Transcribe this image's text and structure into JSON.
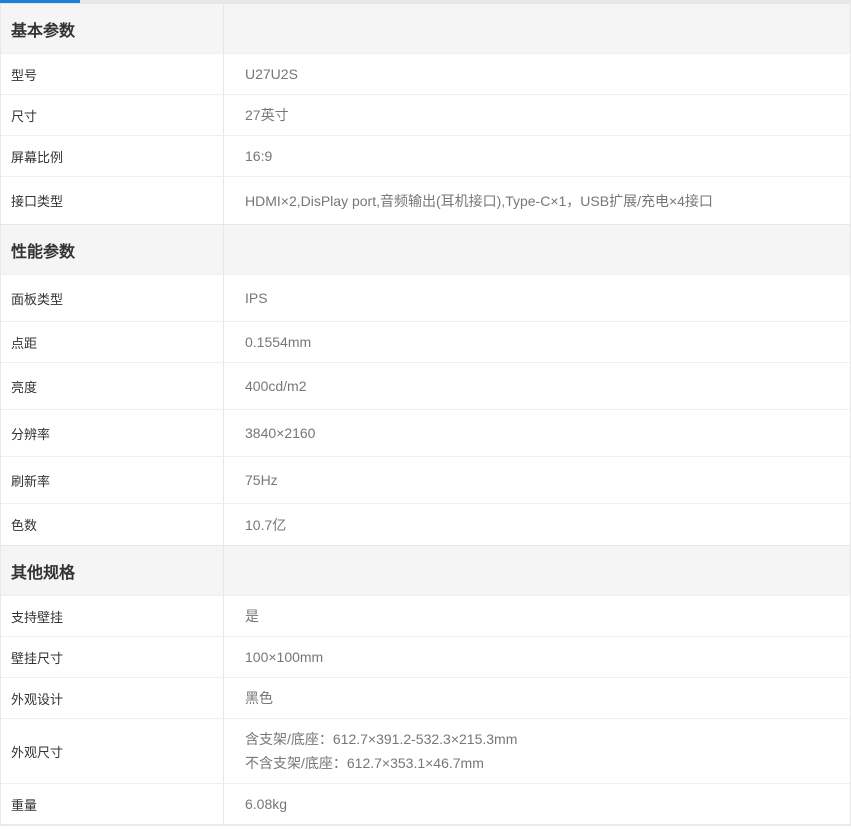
{
  "sections": [
    {
      "title": "基本参数",
      "rows": [
        {
          "label": "型号",
          "values": [
            "U27U2S"
          ]
        },
        {
          "label": "尺寸",
          "values": [
            "27英寸"
          ]
        },
        {
          "label": "屏幕比例",
          "values": [
            "16:9"
          ]
        },
        {
          "label": "接口类型",
          "values": [
            "HDMI×2,DisPlay port,音频输出(耳机接口),Type-C×1，USB扩展/充电×4接口"
          ]
        }
      ]
    },
    {
      "title": "性能参数",
      "rows": [
        {
          "label": "面板类型",
          "values": [
            "IPS"
          ]
        },
        {
          "label": "点距",
          "values": [
            "0.1554mm"
          ]
        },
        {
          "label": "亮度",
          "values": [
            "400cd/m2"
          ]
        },
        {
          "label": "分辨率",
          "values": [
            "3840×2160"
          ]
        },
        {
          "label": "刷新率",
          "values": [
            "75Hz"
          ]
        },
        {
          "label": "色数",
          "values": [
            "10.7亿"
          ]
        }
      ]
    },
    {
      "title": "其他规格",
      "rows": [
        {
          "label": "支持壁挂",
          "values": [
            "是"
          ]
        },
        {
          "label": "壁挂尺寸",
          "values": [
            "100×100mm"
          ]
        },
        {
          "label": "外观设计",
          "values": [
            "黑色"
          ]
        },
        {
          "label": "外观尺寸",
          "values": [
            "含支架/底座：612.7×391.2-532.3×215.3mm",
            "不含支架/底座：612.7×353.1×46.7mm"
          ]
        },
        {
          "label": "重量",
          "values": [
            "6.08kg"
          ]
        }
      ]
    }
  ],
  "colors": {
    "accent": "#1e7fd6",
    "header_bg": "#f5f5f5",
    "label_text": "#333333",
    "value_text": "#777777"
  }
}
